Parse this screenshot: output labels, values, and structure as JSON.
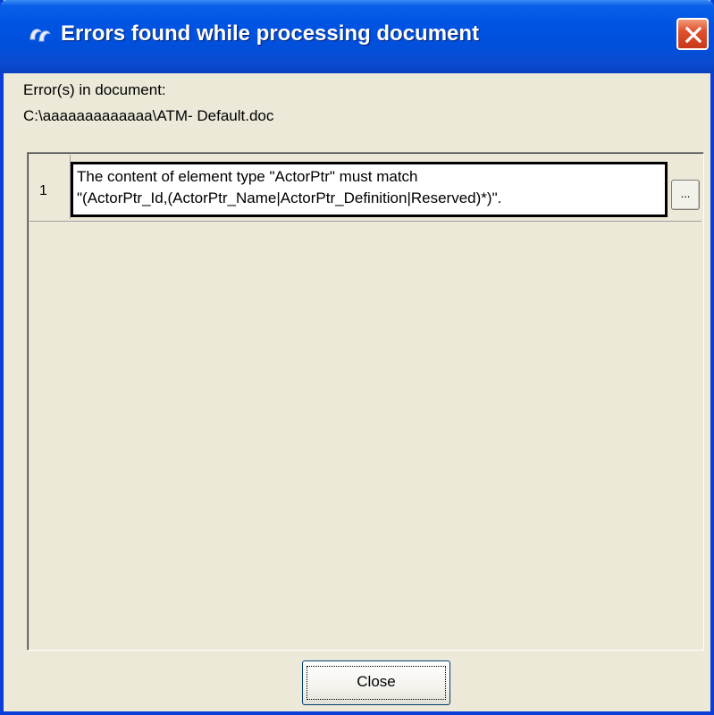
{
  "window": {
    "title": "Errors found while processing document"
  },
  "header": {
    "errors_label": "Error(s) in document:",
    "document_path": "C:\\aaaaaaaaaaaaa\\ATM- Default.doc"
  },
  "errors": [
    {
      "row_number": "1",
      "message_line1": "The content of element type \"ActorPtr\" must match",
      "message_line2": "\"(ActorPtr_Id,(ActorPtr_Name|ActorPtr_Definition|Reserved)*)\".",
      "details_button_label": "..."
    }
  ],
  "footer": {
    "close_label": "Close"
  },
  "colors": {
    "titlebar": "#0054e3",
    "window_bg": "#ece9d8",
    "close_icon_bg": "#e0502c"
  },
  "icons": {
    "title_icon": "app-logo-icon",
    "close_icon": "close-icon"
  }
}
